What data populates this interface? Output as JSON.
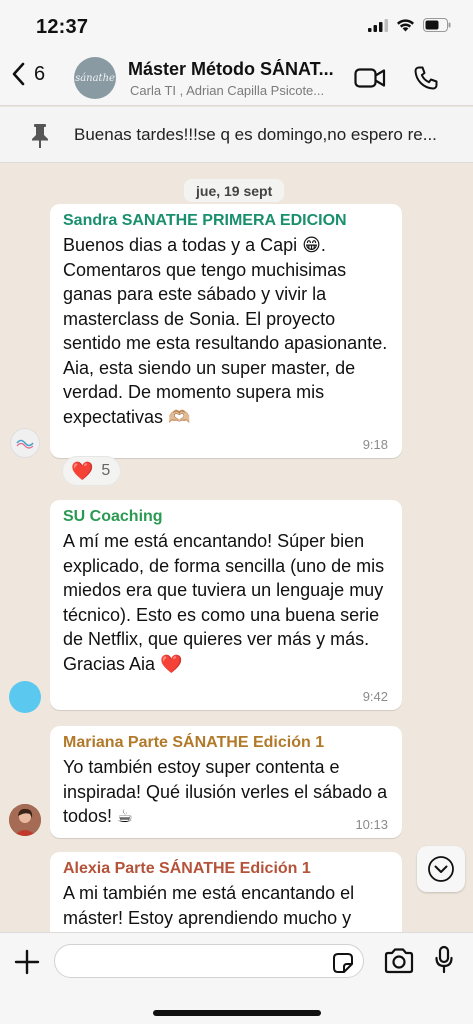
{
  "status_bar": {
    "time": "12:37"
  },
  "header": {
    "back_count": "6",
    "avatar_text": "sánathe",
    "title": "Máster Método SÁNAT...",
    "subtitle": "Carla TI , Adrian Capilla Psicote..."
  },
  "pinned": {
    "text": "Buenas tardes!!!se q es domingo,no espero re..."
  },
  "date_chip": "jue, 19 sept",
  "messages": [
    {
      "sender": "Sandra SANATHE PRIMERA EDICION",
      "sender_color": "#1a8f6e",
      "text": "Buenos dias a todas y a Capi 😁.\nComentaros que tengo muchisimas ganas para este sábado y vivir la masterclass de Sonia. El proyecto sentido me esta resultando apasionante. Aia, esta siendo un super master, de verdad. De momento supera mis expectativas 🫶🏼",
      "time": "9:18",
      "reaction": {
        "emoji": "❤️",
        "count": "5"
      }
    },
    {
      "sender": "SU Coaching",
      "sender_color": "#2a9a52",
      "text": "A mí me está encantando! Súper bien explicado, de forma sencilla (uno de mis miedos era que tuviera un lenguaje muy técnico). Esto es como una buena serie de Netflix, que quieres ver más y más.\nGracias Aia ❤️",
      "time": "9:42"
    },
    {
      "sender": "Mariana Parte SÁNATHE Edición 1",
      "sender_color": "#b07a2a",
      "text": "Yo también estoy super contenta e inspirada! Qué ilusión verles el sábado a todos! ☕",
      "time": "10:13"
    },
    {
      "sender": "Alexia Parte SÁNATHE Edición 1",
      "sender_color": "#b5533a",
      "text": "A mi también me está encantando el máster! Estoy aprendiendo mucho y",
      "time": ""
    }
  ],
  "colors": {
    "avatar_blue": "#5bc8f0",
    "accent_icon": "#1c1c1e"
  }
}
